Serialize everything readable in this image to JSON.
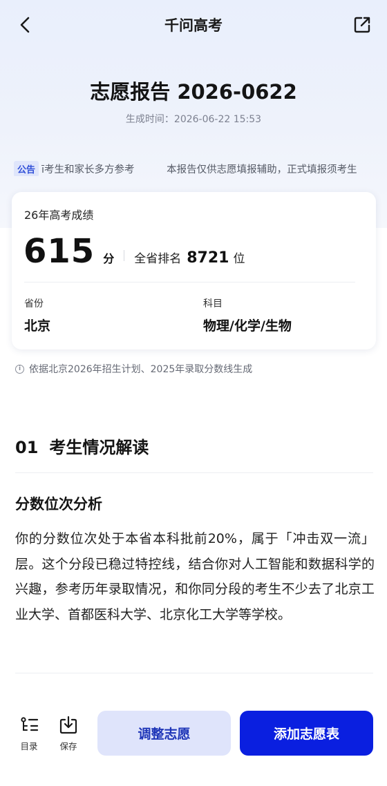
{
  "header": {
    "title": "千问高考"
  },
  "report": {
    "title": "志愿报告 2026-0622",
    "time": "生成时间：2026-06-22 15:53"
  },
  "notice": {
    "tag": "公告",
    "items": [
      "ī考生和家长多方参考",
      "本报告仅供志愿填报辅助，正式填报须考生"
    ]
  },
  "score_card": {
    "year_label": "26年高考成绩",
    "score": "615",
    "score_unit": "分",
    "rank_label": "全省排名",
    "rank": "8721",
    "rank_unit": "位",
    "province_label": "省份",
    "province": "北京",
    "subjects_label": "科目",
    "subjects": "物理/化学/生物"
  },
  "basis_note": "依据北京2026年招生计划、2025年录取分数线生成",
  "section": {
    "number": "01",
    "title": "考生情况解读",
    "subtitle": "分数位次分析",
    "paragraph": "你的分数位次处于本省本科批前20%，属于「冲击双一流」层。这个分段已稳过特控线，结合你对人工智能和数据科学的兴趣，参考历年录取情况，和你同分段的考生不少去了北京工业大学、首都医科大学、北京化工大学等学校。"
  },
  "bottom_bar": {
    "toc_label": "目录",
    "save_label": "保存",
    "adjust_label": "调整志愿",
    "add_label": "添加志愿表"
  },
  "colors": {
    "primary": "#0a1fe0",
    "secondary_bg": "#dfe4fb",
    "secondary_text": "#1f36b8"
  },
  "icons": {
    "back": "chevron-left-icon",
    "share": "share-icon",
    "info": "info-icon",
    "toc": "list-icon",
    "save": "download-icon"
  }
}
